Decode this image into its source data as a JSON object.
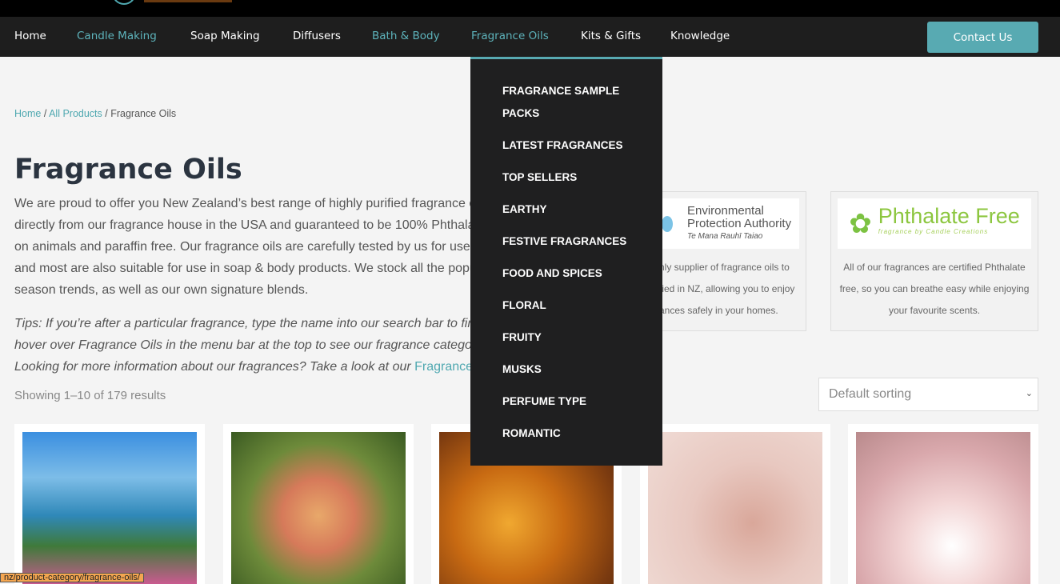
{
  "nav": {
    "items": [
      {
        "label": "Home",
        "active": false
      },
      {
        "label": "Candle Making",
        "active": true
      },
      {
        "label": "Soap Making",
        "active": false
      },
      {
        "label": "Diffusers",
        "active": false
      },
      {
        "label": "Bath & Body",
        "active": true
      },
      {
        "label": "Fragrance Oils",
        "active": true
      },
      {
        "label": "Kits & Gifts",
        "active": false
      },
      {
        "label": "Knowledge",
        "active": false
      }
    ],
    "contact": "Contact Us"
  },
  "dropdown": [
    "FRAGRANCE SAMPLE PACKS",
    "LATEST FRAGRANCES",
    "TOP SELLERS",
    "EARTHY",
    "FESTIVE FRAGRANCES",
    "FOOD AND SPICES",
    "FLORAL",
    "FRUITY",
    "MUSKS",
    "PERFUME TYPE",
    "ROMANTIC"
  ],
  "breadcrumb": {
    "home": "Home",
    "sep": " / ",
    "all": "All Products",
    "current": "Fragrance Oils"
  },
  "title": "Fragrance Oils",
  "intro": [
    "We are proud to offer you New Zealand’s best range of highly purified fragrance o",
    "directly from our fragrance house in the USA and guaranteed to be 100% Phthalat",
    "on animals and paraffin free. Our fragrance oils are carefully tested by us for use",
    "and most are also suitable for use in soap & body products. We stock all the popu",
    "season trends, as well as our own signature blends."
  ],
  "tips": [
    "Tips: If you’re after a particular fragrance, type the name into our search bar to fin",
    "hover over Fragrance Oils in the menu bar at the top to see our fragrance categor",
    "Looking for more information about our fragrances? Take a look at our "
  ],
  "tips_link": "Fragrance",
  "showing": "Showing 1–10 of 179 results",
  "cards": [
    {
      "logo_title": "Environmental",
      "logo_title2": "Protection Authority",
      "logo_sub": "Te Mana Rauhī Taiao",
      "text": "nly supplier of fragrance oils to fied in NZ, allowing you to enjoy ances safely in your homes."
    },
    {
      "logo_title": "Phthalate Free",
      "logo_sub": "fragrance by Candle Creations",
      "text": "All of our fragrances are certified Phthalate free, so you can breathe easy while enjoying your favourite scents."
    }
  ],
  "sort": {
    "selected": "Default sorting"
  },
  "status_url": "nz/product-category/fragrance-oils/",
  "colors": {
    "accent": "#58aab2",
    "nav_bg": "#1e1e1e",
    "dropdown_bg": "#1f1f20"
  }
}
